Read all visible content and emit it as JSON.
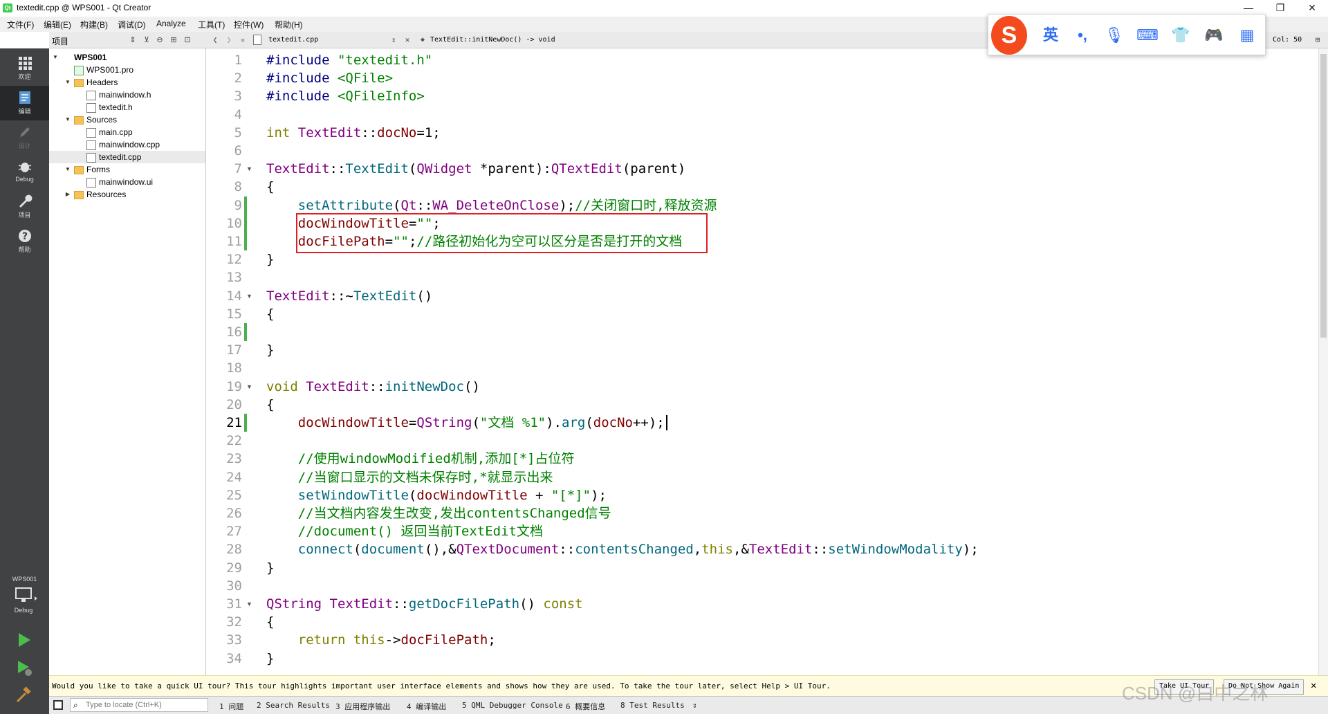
{
  "window": {
    "title": "textedit.cpp @ WPS001 - Qt Creator",
    "app_icon": "qt-creator-icon",
    "controls": [
      "minimize",
      "maximize",
      "close"
    ]
  },
  "menubar": [
    "文件(F)",
    "编辑(E)",
    "构建(B)",
    "调试(D)",
    "Analyze",
    "工具(T)",
    "控件(W)",
    "帮助(H)"
  ],
  "modes": [
    {
      "label": "欢迎",
      "icon": "grid-icon"
    },
    {
      "label": "编辑",
      "icon": "edit-icon"
    },
    {
      "label": "设计",
      "icon": "pencil-icon"
    },
    {
      "label": "Debug",
      "icon": "bug-icon"
    },
    {
      "label": "项目",
      "icon": "wrench-icon"
    },
    {
      "label": "帮助",
      "icon": "help-icon"
    }
  ],
  "kit": {
    "project": "WPS001",
    "mode": "Debug"
  },
  "project_panel": {
    "title": "项目",
    "tree": [
      {
        "label": "WPS001",
        "level": 0,
        "expanded": true,
        "kind": "project"
      },
      {
        "label": "WPS001.pro",
        "level": 1,
        "kind": "pro"
      },
      {
        "label": "Headers",
        "level": 1,
        "expanded": true,
        "kind": "folder"
      },
      {
        "label": "mainwindow.h",
        "level": 2,
        "kind": "file"
      },
      {
        "label": "textedit.h",
        "level": 2,
        "kind": "file"
      },
      {
        "label": "Sources",
        "level": 1,
        "expanded": true,
        "kind": "folder"
      },
      {
        "label": "main.cpp",
        "level": 2,
        "kind": "file"
      },
      {
        "label": "mainwindow.cpp",
        "level": 2,
        "kind": "file"
      },
      {
        "label": "textedit.cpp",
        "level": 2,
        "kind": "file",
        "selected": true
      },
      {
        "label": "Forms",
        "level": 1,
        "expanded": true,
        "kind": "folder"
      },
      {
        "label": "mainwindow.ui",
        "level": 2,
        "kind": "file"
      },
      {
        "label": "Resources",
        "level": 1,
        "expanded": false,
        "kind": "folder"
      }
    ]
  },
  "editor_toolbar": {
    "file": "textedit.cpp",
    "symbol": "TextEdit::initNewDoc() -> void",
    "col": "Col: 50"
  },
  "editor": {
    "current_line": 21,
    "lines": [
      {
        "n": "1",
        "t": [
          [
            "#include ",
            "#000080"
          ],
          [
            "\"textedit.h\"",
            "#008000"
          ]
        ]
      },
      {
        "n": "2",
        "t": [
          [
            "#include ",
            "#000080"
          ],
          [
            "<QFile>",
            "#008000"
          ]
        ]
      },
      {
        "n": "3",
        "t": [
          [
            "#include ",
            "#000080"
          ],
          [
            "<QFileInfo>",
            "#008000"
          ]
        ]
      },
      {
        "n": "4",
        "t": []
      },
      {
        "n": "5",
        "t": [
          [
            "int ",
            "#808000"
          ],
          [
            "TextEdit",
            "#800080"
          ],
          [
            "::",
            "#000"
          ],
          [
            "docNo",
            "#800000"
          ],
          [
            "=1;",
            "#000"
          ]
        ]
      },
      {
        "n": "6",
        "t": []
      },
      {
        "n": "7",
        "t": [
          [
            "TextEdit",
            "#800080"
          ],
          [
            "::",
            "#000"
          ],
          [
            "TextEdit",
            "#00677c"
          ],
          [
            "(",
            "#000"
          ],
          [
            "QWidget",
            "#800080"
          ],
          [
            " *parent",
            "#000"
          ],
          [
            "):",
            "#000"
          ],
          [
            "QTextEdit",
            "#800080"
          ],
          [
            "(parent)",
            "#000"
          ]
        ]
      },
      {
        "n": "8",
        "t": [
          [
            "{",
            "#000"
          ]
        ]
      },
      {
        "n": "9",
        "t": [
          [
            "    ",
            "#000"
          ],
          [
            "setAttribute",
            "#00677c"
          ],
          [
            "(",
            "#000"
          ],
          [
            "Qt",
            "#800080"
          ],
          [
            "::",
            "#000"
          ],
          [
            "WA_DeleteOnClose",
            "#800080"
          ],
          [
            ");",
            "#000"
          ],
          [
            "//关闭窗口时,释放资源",
            "#008000"
          ]
        ]
      },
      {
        "n": "10",
        "t": [
          [
            "    ",
            "#000"
          ],
          [
            "docWindowTitle",
            "#800000"
          ],
          [
            "=",
            "#000"
          ],
          [
            "\"\"",
            "#008000"
          ],
          [
            ";",
            "#000"
          ]
        ]
      },
      {
        "n": "11",
        "t": [
          [
            "    ",
            "#000"
          ],
          [
            "docFilePath",
            "#800000"
          ],
          [
            "=",
            "#000"
          ],
          [
            "\"\"",
            "#008000"
          ],
          [
            ";",
            "#000"
          ],
          [
            "//路径初始化为空可以区分是否是打开的文档",
            "#008000"
          ]
        ]
      },
      {
        "n": "12",
        "t": [
          [
            "}",
            "#000"
          ]
        ]
      },
      {
        "n": "13",
        "t": []
      },
      {
        "n": "14",
        "t": [
          [
            "TextEdit",
            "#800080"
          ],
          [
            "::~",
            "#000"
          ],
          [
            "TextEdit",
            "#00677c"
          ],
          [
            "()",
            "#000"
          ]
        ]
      },
      {
        "n": "15",
        "t": [
          [
            "{",
            "#000"
          ]
        ]
      },
      {
        "n": "16",
        "t": []
      },
      {
        "n": "17",
        "t": [
          [
            "}",
            "#000"
          ]
        ]
      },
      {
        "n": "18",
        "t": []
      },
      {
        "n": "19",
        "t": [
          [
            "void ",
            "#808000"
          ],
          [
            "TextEdit",
            "#800080"
          ],
          [
            "::",
            "#000"
          ],
          [
            "initNewDoc",
            "#00677c"
          ],
          [
            "()",
            "#000"
          ]
        ]
      },
      {
        "n": "20",
        "t": [
          [
            "{",
            "#000"
          ]
        ]
      },
      {
        "n": "21",
        "t": [
          [
            "    ",
            "#000"
          ],
          [
            "docWindowTitle",
            "#800000"
          ],
          [
            "=",
            "#000"
          ],
          [
            "QString",
            "#800080"
          ],
          [
            "(",
            "#000"
          ],
          [
            "\"文档 %1\"",
            "#008000"
          ],
          [
            ").",
            "#000"
          ],
          [
            "arg",
            "#00677c"
          ],
          [
            "(",
            "#000"
          ],
          [
            "docNo",
            "#800000"
          ],
          [
            "++);",
            "#000"
          ]
        ]
      },
      {
        "n": "22",
        "t": []
      },
      {
        "n": "23",
        "t": [
          [
            "    ",
            "#000"
          ],
          [
            "//使用windowModified机制,添加[*]占位符",
            "#008000"
          ]
        ]
      },
      {
        "n": "24",
        "t": [
          [
            "    ",
            "#000"
          ],
          [
            "//当窗口显示的文档未保存时,*就显示出来",
            "#008000"
          ]
        ]
      },
      {
        "n": "25",
        "t": [
          [
            "    ",
            "#000"
          ],
          [
            "setWindowTitle",
            "#00677c"
          ],
          [
            "(",
            "#000"
          ],
          [
            "docWindowTitle",
            "#800000"
          ],
          [
            " + ",
            "#000"
          ],
          [
            "\"[*]\"",
            "#008000"
          ],
          [
            ");",
            "#000"
          ]
        ]
      },
      {
        "n": "26",
        "t": [
          [
            "    ",
            "#000"
          ],
          [
            "//当文档内容发生改变,发出contentsChanged信号",
            "#008000"
          ]
        ]
      },
      {
        "n": "27",
        "t": [
          [
            "    ",
            "#000"
          ],
          [
            "//document() 返回当前TextEdit文档",
            "#008000"
          ]
        ]
      },
      {
        "n": "28",
        "t": [
          [
            "    ",
            "#000"
          ],
          [
            "connect",
            "#00677c"
          ],
          [
            "(",
            "#000"
          ],
          [
            "document",
            "#00677c"
          ],
          [
            "(),&",
            "#000"
          ],
          [
            "QTextDocument",
            "#800080"
          ],
          [
            "::",
            "#000"
          ],
          [
            "contentsChanged",
            "#00677c"
          ],
          [
            ",",
            "#000"
          ],
          [
            "this",
            "#808000"
          ],
          [
            ",&",
            "#000"
          ],
          [
            "TextEdit",
            "#800080"
          ],
          [
            "::",
            "#000"
          ],
          [
            "setWindowModality",
            "#00677c"
          ],
          [
            ");",
            "#000"
          ]
        ]
      },
      {
        "n": "29",
        "t": [
          [
            "}",
            "#000"
          ]
        ]
      },
      {
        "n": "30",
        "t": []
      },
      {
        "n": "31",
        "t": [
          [
            "QString ",
            "#800080"
          ],
          [
            "TextEdit",
            "#800080"
          ],
          [
            "::",
            "#000"
          ],
          [
            "getDocFilePath",
            "#00677c"
          ],
          [
            "() ",
            "#000"
          ],
          [
            "const",
            "#808000"
          ]
        ]
      },
      {
        "n": "32",
        "t": [
          [
            "{",
            "#000"
          ]
        ]
      },
      {
        "n": "33",
        "t": [
          [
            "    ",
            "#000"
          ],
          [
            "return ",
            "#808000"
          ],
          [
            "this",
            "#808000"
          ],
          [
            "->",
            "#000"
          ],
          [
            "docFilePath",
            "#800000"
          ],
          [
            ";",
            "#000"
          ]
        ]
      },
      {
        "n": "34",
        "t": [
          [
            "}",
            "#000"
          ]
        ]
      }
    ]
  },
  "infobar": {
    "text": "Would you like to take a quick UI tour? This tour highlights important user interface elements and shows how they are used. To take the tour later, select Help > UI Tour.",
    "take_tour": "Take UI Tour",
    "dont_show": "Do Not Show Again"
  },
  "statusbar": {
    "locator_placeholder": "Type to locate (Ctrl+K)",
    "panes": [
      "1 问题",
      "2 Search Results",
      "3 应用程序输出",
      "4 编译输出",
      "5 QML Debugger Console",
      "6 概要信息",
      "8 Test Results"
    ]
  },
  "ime": {
    "lang": "英",
    "punct": "•,",
    "icons": [
      "sogou-logo-icon",
      "mic-icon",
      "keyboard-icon",
      "shirt-icon",
      "gamepad-icon",
      "apps-icon"
    ]
  },
  "watermark": "CSDN @白中之林",
  "colors": {
    "accent": "#41cd52",
    "mode_bar": "#404244",
    "highlight_box": "#e02020"
  }
}
